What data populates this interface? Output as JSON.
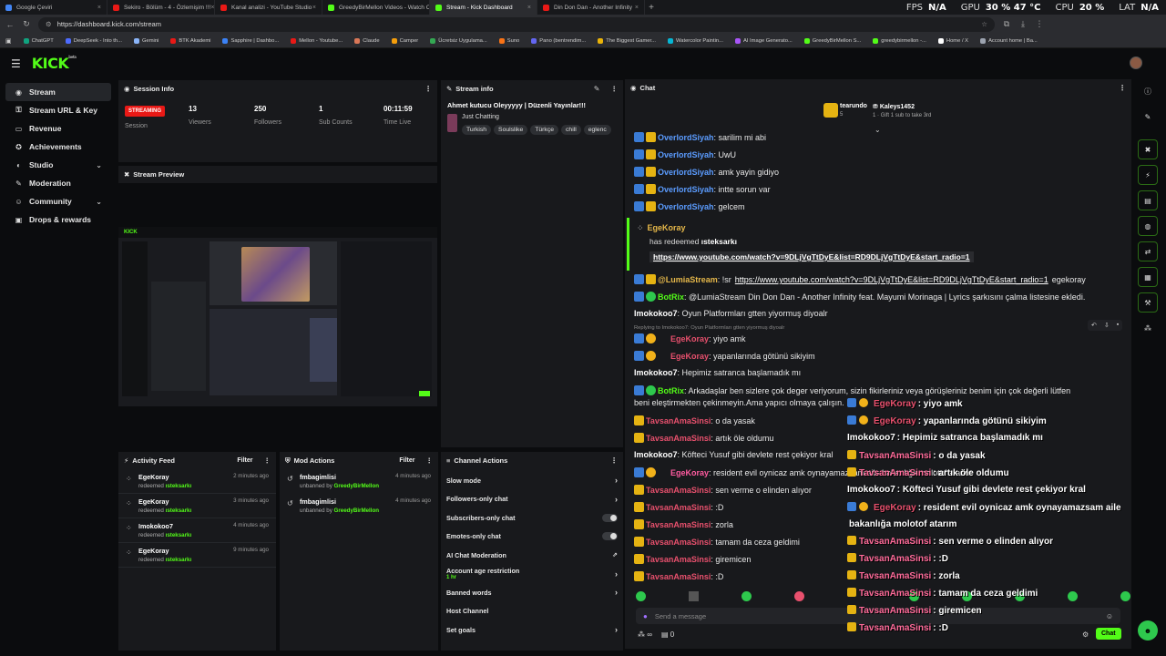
{
  "browser": {
    "tabs": [
      {
        "title": "Google Çeviri",
        "color": "#4285f4",
        "active": false
      },
      {
        "title": "Sekiro - Bölüm - 4 - Özlemişim !!!",
        "color": "#e91916",
        "active": false
      },
      {
        "title": "Kanal analizi - YouTube Studio",
        "color": "#e91916",
        "active": false
      },
      {
        "title": "GreedyBirMellon Videos - Watch Cl",
        "color": "#53fc18",
        "active": false
      },
      {
        "title": "Stream - Kick Dashboard",
        "color": "#53fc18",
        "active": true
      },
      {
        "title": "Din Don Dan - Another Infinity",
        "color": "#e91916",
        "active": false
      }
    ],
    "new_tab": "+",
    "hud": {
      "fps_label": "FPS",
      "fps_value": "N/A",
      "gpu_label": "GPU",
      "gpu_value": "30 % 47 °C",
      "cpu_label": "CPU",
      "cpu_value": "20 %",
      "lat_label": "LAT",
      "lat_value": "N/A"
    },
    "url": "https://dashboard.kick.com/stream",
    "bookmarks": [
      "ChatGPT",
      "DeepSeek - Into th...",
      "Gemini",
      "BTK Akademi",
      "Sapphire | Dashbo...",
      "Mellon - Youtube...",
      "Claude",
      "Camper",
      "Ücretsiz Uygulama...",
      "Suno",
      "Pano (bentrendim...",
      "The Biggest Gamer...",
      "Watercolor Paintin...",
      "AI Image Generato...",
      "GreedyBirMellon S...",
      "greedybirmellon -...",
      "Home / X",
      "Account home | Ba..."
    ]
  },
  "header": {
    "logo": "KICK",
    "logo_sup": "beta"
  },
  "sidebar": {
    "items": [
      {
        "label": "Stream",
        "icon": "◉",
        "active": true,
        "chev": ""
      },
      {
        "label": "Stream URL & Key",
        "icon": "⚿",
        "active": false,
        "chev": ""
      },
      {
        "label": "Revenue",
        "icon": "▭",
        "active": false,
        "chev": ""
      },
      {
        "label": "Achievements",
        "icon": "✪",
        "active": false,
        "chev": ""
      },
      {
        "label": "Studio",
        "icon": "◐",
        "active": false,
        "chev": "⌄"
      },
      {
        "label": "Moderation",
        "icon": "✎",
        "active": false,
        "chev": ""
      },
      {
        "label": "Community",
        "icon": "☺",
        "active": false,
        "chev": "⌄"
      },
      {
        "label": "Drops & rewards",
        "icon": "▣",
        "active": false,
        "chev": ""
      }
    ]
  },
  "session": {
    "title": "Session Info",
    "status": "STREAMING",
    "session_label": "Session",
    "stats": [
      {
        "value": "13",
        "label": "Viewers"
      },
      {
        "value": "250",
        "label": "Followers"
      },
      {
        "value": "1",
        "label": "Sub Counts"
      },
      {
        "value": "00:11:59",
        "label": "Time Live"
      }
    ]
  },
  "stream_info": {
    "title": "Stream info",
    "stream_title": "Ahmet kutucu Oleyyyyy | Düzenli Yayınlar!!!",
    "category": "Just Chatting",
    "tags": [
      "Turkish",
      "Soulslike",
      "Türkçe",
      "chill",
      "eglenc"
    ]
  },
  "preview": {
    "title": "Stream Preview"
  },
  "activity": {
    "title": "Activity Feed",
    "filter": "Filter",
    "rows": [
      {
        "name": "EgeKoray",
        "text": "redeemed",
        "reward": "ısteksarkı",
        "time": "2 minutes ago"
      },
      {
        "name": "EgeKoray",
        "text": "redeemed",
        "reward": "ısteksarkı",
        "time": "3 minutes ago"
      },
      {
        "name": "Imokokoo7",
        "text": "redeemed",
        "reward": "ısteksarkı",
        "time": "4 minutes ago"
      },
      {
        "name": "EgeKoray",
        "text": "redeemed",
        "reward": "ısteksarkı",
        "time": "9 minutes ago"
      }
    ]
  },
  "mod": {
    "title": "Mod Actions",
    "filter": "Filter",
    "rows": [
      {
        "name": "fmbagimlisi",
        "text": "unbanned by",
        "by": "GreedyBirMellon",
        "time": "4 minutes ago"
      },
      {
        "name": "fmbagimlisi",
        "text": "unbanned by",
        "by": "GreedyBirMellon",
        "time": "4 minutes ago"
      }
    ]
  },
  "channel_actions": {
    "title": "Channel Actions",
    "rows": [
      {
        "label": "Slow mode",
        "kind": "arrow",
        "sub": ""
      },
      {
        "label": "Followers-only chat",
        "kind": "arrow",
        "sub": ""
      },
      {
        "label": "Subscribers-only chat",
        "kind": "toggle",
        "sub": ""
      },
      {
        "label": "Emotes-only chat",
        "kind": "toggle",
        "sub": ""
      },
      {
        "label": "AI Chat Moderation",
        "kind": "ext",
        "sub": ""
      },
      {
        "label": "Account age restriction",
        "kind": "arrow",
        "sub": "1 hr"
      },
      {
        "label": "Banned words",
        "kind": "arrow",
        "sub": ""
      },
      {
        "label": "Host Channel",
        "kind": "none",
        "sub": ""
      },
      {
        "label": "Set goals",
        "kind": "arrow",
        "sub": ""
      }
    ]
  },
  "chat": {
    "title": "Chat",
    "gifter": {
      "name": "tearundo",
      "count": "5"
    },
    "gifter2": {
      "name": "Kaleys1452",
      "count": "1",
      "note": "Gift 1 sub to take 3rd"
    },
    "messages": [
      {
        "user": "OverlordSiyah",
        "color": "u-blue",
        "badges": [
          "bb",
          "bg"
        ],
        "text": ": sarilim mi abi"
      },
      {
        "user": "OverlordSiyah",
        "color": "u-blue",
        "badges": [
          "bb",
          "bg"
        ],
        "text": ": UwU"
      },
      {
        "user": "OverlordSiyah",
        "color": "u-blue",
        "badges": [
          "bb",
          "bg"
        ],
        "text": ": amk yayin gidiyo"
      },
      {
        "user": "OverlordSiyah",
        "color": "u-blue",
        "badges": [
          "bb",
          "bg"
        ],
        "text": ": intte sorun var"
      },
      {
        "user": "OverlordSiyah",
        "color": "u-blue",
        "badges": [
          "bb",
          "bg"
        ],
        "text": ": gelcem"
      }
    ],
    "redeem": {
      "user": "EgeKoray",
      "text": "has redeemed",
      "reward": "ısteksarkı",
      "link": "https://www.youtube.com/watch?v=9DLjVgTtDyE&list=RD9DLjVgTtDyE&start_radio=1"
    },
    "lumia": {
      "user": "@LumiaStream",
      "cmd": ": !sr",
      "link": "https://www.youtube.com/watch?v=9DLjVgTtDyE&list=RD9DLjVgTtDyE&start_radio=1",
      "tail": "egekoray"
    },
    "botrix1": {
      "user": "BotRix",
      "text": ": @LumiaStream Din Don Dan - Another Infinity feat. Mayumi Morinaga | Lyrics şarkısını çalma listesine ekledi."
    },
    "imoko1": {
      "user": "Imokokoo7",
      "text": ": Oyun Platformları gtten yiyormuş diyoalr"
    },
    "reply_note": "Replying to Imokokoo7: Oyun Platformları gtten yiyormuş diyoalr",
    "m_yiyo": {
      "user": "EgeKoray",
      "text": ": yiyo amk"
    },
    "m_yapan": {
      "user": "EgeKoray",
      "text": ": yapanlarında götünü sikiyim"
    },
    "m_imoko2": {
      "user": "Imokokoo7",
      "text": ": Hepimiz satranca başlamadık mı"
    },
    "botrix2": {
      "user": "BotRix",
      "text": ": Arkadaşlar ben sizlere çok deger veriyorum, sizin fikirleriniz veya görüşleriniz benim için çok değerli lütfen",
      "text2": "beni eleştirmekten çekinmeyin.Ama yapıcı olmaya çalışın."
    },
    "tail": [
      {
        "user": "TavsanAmaSinsi",
        "color": "u-red",
        "badge": "bg",
        "text": ": o da yasak"
      },
      {
        "user": "TavsanAmaSinsi",
        "color": "u-red",
        "badge": "bg",
        "text": ": artık öle oldumu"
      },
      {
        "user": "Imokokoo7",
        "color": "u-white",
        "badge": "",
        "text": ": Köfteci Yusuf gibi devlete rest çekiyor kral"
      },
      {
        "user": "EgeKoray",
        "color": "u-pink",
        "badge": "eg",
        "text": ": resident evil oynicaz amk oynayamazsam aile bakanlığa molotof atarım"
      },
      {
        "user": "TavsanAmaSinsi",
        "color": "u-red",
        "badge": "bg",
        "text": ": sen verme o elinden alıyor"
      },
      {
        "user": "TavsanAmaSinsi",
        "color": "u-red",
        "badge": "bg",
        "text": ": :D"
      },
      {
        "user": "TavsanAmaSinsi",
        "color": "u-red",
        "badge": "bg",
        "text": ": zorla"
      },
      {
        "user": "TavsanAmaSinsi",
        "color": "u-red",
        "badge": "bg",
        "text": ": tamam da ceza geldimi"
      },
      {
        "user": "TavsanAmaSinsi",
        "color": "u-red",
        "badge": "bg",
        "text": ": giremicen"
      },
      {
        "user": "TavsanAmaSinsi",
        "color": "u-red",
        "badge": "bg",
        "text": ": :D"
      }
    ],
    "input_placeholder": "Send a message",
    "count": "0",
    "send": "Chat"
  },
  "overlay": [
    {
      "user": "EgeKoray",
      "text": ": yiyo amk"
    },
    {
      "user": "EgeKoray",
      "text": ": yapanlarında götünü sikiyim"
    },
    {
      "user": "Imokokoo7",
      "text": ": Hepimiz satranca başlamadık mı"
    },
    {
      "user": "TavsanAmaSinsi",
      "text": ": o da yasak"
    },
    {
      "user": "TavsanAmaSinsi",
      "text": ": artık öle oldumu"
    },
    {
      "user": "Imokokoo7",
      "text": ": Köfteci Yusuf gibi devlete rest çekiyor kral"
    },
    {
      "user": "EgeKoray",
      "text": ": resident evil oynicaz amk oynayamazsam aile"
    },
    {
      "user": "",
      "text": "bakanlığa molotof atarım"
    },
    {
      "user": "TavsanAmaSinsi",
      "text": ": sen verme o elinden alıyor"
    },
    {
      "user": "TavsanAmaSinsi",
      "text": ": :D"
    },
    {
      "user": "TavsanAmaSinsi",
      "text": ": zorla"
    },
    {
      "user": "TavsanAmaSinsi",
      "text": ": tamam da ceza geldimi"
    },
    {
      "user": "TavsanAmaSinsi",
      "text": ": giremicen"
    },
    {
      "user": "TavsanAmaSinsi",
      "text": ": :D"
    }
  ],
  "colors": {
    "accent": "#53fc18",
    "live": "#e91916"
  }
}
